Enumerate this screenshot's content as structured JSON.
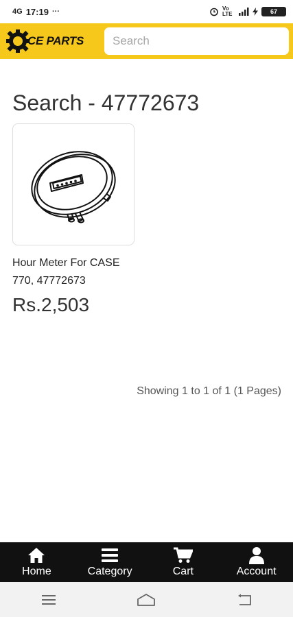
{
  "status_bar": {
    "signal_text": "4G",
    "time": "17:19",
    "dots": "···",
    "vo_lte": "Vo LTE",
    "battery": "67"
  },
  "header": {
    "logo_text": "CE PARTS",
    "search_placeholder": "Search"
  },
  "main": {
    "title": "Search - 47772673",
    "products": [
      {
        "name": "Hour Meter For CASE 770, 47772673",
        "price": "Rs.2,503"
      }
    ],
    "pagination": "Showing 1 to 1 of 1 (1 Pages)"
  },
  "bottom_nav": {
    "items": [
      {
        "label": "Home",
        "icon": "home-icon"
      },
      {
        "label": "Category",
        "icon": "menu-icon"
      },
      {
        "label": "Cart",
        "icon": "cart-icon"
      },
      {
        "label": "Account",
        "icon": "user-icon"
      }
    ]
  },
  "system_nav": {
    "icons": [
      "recent-apps-icon",
      "home-icon",
      "back-icon"
    ]
  },
  "colors": {
    "brand": "#f7c81c",
    "nav_bg": "#111111"
  }
}
